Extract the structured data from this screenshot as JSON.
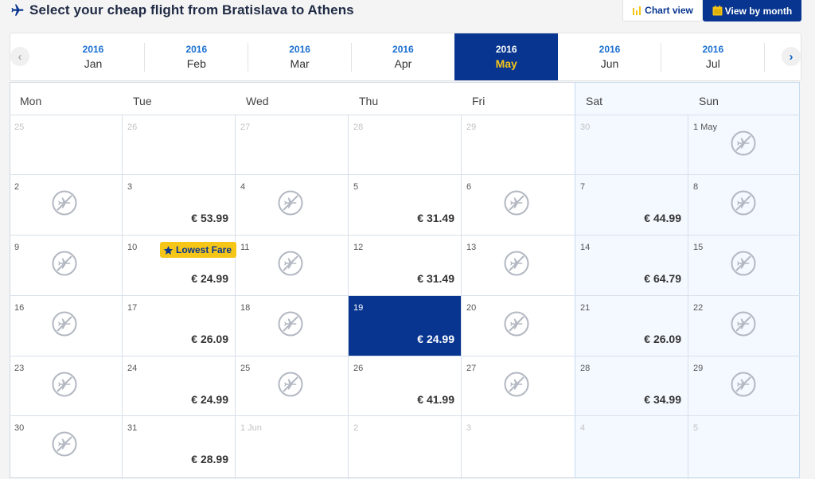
{
  "header": {
    "title": "Select your cheap flight from Bratislava to Athens",
    "chart_view_label": "Chart view",
    "view_by_month_label": "View by month"
  },
  "months": [
    {
      "year": "2016",
      "name": "Jan"
    },
    {
      "year": "2016",
      "name": "Feb"
    },
    {
      "year": "2016",
      "name": "Mar"
    },
    {
      "year": "2016",
      "name": "Apr"
    },
    {
      "year": "2016",
      "name": "May",
      "active": true
    },
    {
      "year": "2016",
      "name": "Jun"
    },
    {
      "year": "2016",
      "name": "Jul"
    }
  ],
  "weekdays": [
    "Mon",
    "Tue",
    "Wed",
    "Thu",
    "Fri",
    "Sat",
    "Sun"
  ],
  "weeks": [
    [
      {
        "day": "25",
        "out": true
      },
      {
        "day": "26",
        "out": true
      },
      {
        "day": "27",
        "out": true
      },
      {
        "day": "28",
        "out": true
      },
      {
        "day": "29",
        "out": true
      },
      {
        "day": "30",
        "out": true
      },
      {
        "day": "1 May",
        "noflight": true
      }
    ],
    [
      {
        "day": "2",
        "noflight": true
      },
      {
        "day": "3",
        "price": "€ 53.99"
      },
      {
        "day": "4",
        "noflight": true
      },
      {
        "day": "5",
        "price": "€ 31.49"
      },
      {
        "day": "6",
        "noflight": true
      },
      {
        "day": "7",
        "price": "€ 44.99"
      },
      {
        "day": "8",
        "noflight": true
      }
    ],
    [
      {
        "day": "9",
        "noflight": true
      },
      {
        "day": "10",
        "price": "€ 24.99",
        "lowest": true
      },
      {
        "day": "11",
        "noflight": true
      },
      {
        "day": "12",
        "price": "€ 31.49"
      },
      {
        "day": "13",
        "noflight": true
      },
      {
        "day": "14",
        "price": "€ 64.79"
      },
      {
        "day": "15",
        "noflight": true
      }
    ],
    [
      {
        "day": "16",
        "noflight": true
      },
      {
        "day": "17",
        "price": "€ 26.09"
      },
      {
        "day": "18",
        "noflight": true
      },
      {
        "day": "19",
        "price": "€ 24.99",
        "selected": true
      },
      {
        "day": "20",
        "noflight": true
      },
      {
        "day": "21",
        "price": "€ 26.09"
      },
      {
        "day": "22",
        "noflight": true
      }
    ],
    [
      {
        "day": "23",
        "noflight": true
      },
      {
        "day": "24",
        "price": "€ 24.99"
      },
      {
        "day": "25",
        "noflight": true
      },
      {
        "day": "26",
        "price": "€ 41.99"
      },
      {
        "day": "27",
        "noflight": true
      },
      {
        "day": "28",
        "price": "€ 34.99"
      },
      {
        "day": "29",
        "noflight": true
      }
    ],
    [
      {
        "day": "30",
        "noflight": true
      },
      {
        "day": "31",
        "price": "€ 28.99"
      },
      {
        "day": "1 Jun",
        "out": true
      },
      {
        "day": "2",
        "out": true
      },
      {
        "day": "3",
        "out": true
      },
      {
        "day": "4",
        "out": true
      },
      {
        "day": "5",
        "out": true
      }
    ]
  ],
  "lowest_fare_label": "Lowest Fare",
  "icons": {
    "title": "plane-icon",
    "chart": "bar-chart-icon",
    "month": "calendar-icon",
    "prev": "chevron-left-icon",
    "next": "chevron-right-icon",
    "no_flight": "no-flight-icon",
    "badge": "star-icon"
  },
  "colors": {
    "brand_blue": "#073590",
    "accent_yellow": "#f5c518",
    "year_blue": "#1a6fd0"
  }
}
